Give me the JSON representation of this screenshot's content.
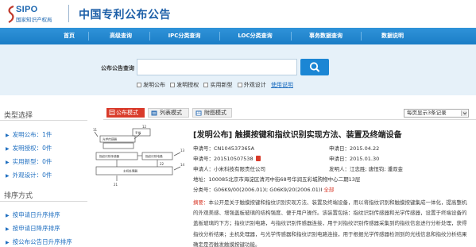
{
  "header": {
    "logo_text": "SIPO",
    "logo_sub": "国家知识产权局",
    "site_title": "中国专利公布公告"
  },
  "nav": {
    "items": [
      "首页",
      "高级查询",
      "IPC分类查询",
      "LOC分类查询",
      "事务数据查询",
      "数据说明"
    ]
  },
  "search": {
    "label": "公布公告查询",
    "value": "",
    "placeholder": "",
    "filters": [
      "发明公布",
      "发明授权",
      "实用新型",
      "外观设计"
    ],
    "help_link": "使用说明"
  },
  "sidebar": {
    "type_heading": "类型选择",
    "types": [
      "发明公布：1件",
      "发明授权：0件",
      "实用新型：0件",
      "外观设计：0件"
    ],
    "sort_heading": "排序方式",
    "sorts": [
      "按申请日升序排序",
      "按申请日降序排序",
      "按公布公告日升序排序"
    ]
  },
  "view": {
    "tabs": [
      "公布模式",
      "列表模式",
      "附图模式"
    ],
    "page_size": "每页显示3条记录"
  },
  "record": {
    "title": "[发明公布] 触摸按键和指纹识别实现方法、装置及终端设备",
    "app_no": "申请号：CN104537365A",
    "app_date": "申请日：2015.04.22",
    "pub_no": "申请号：201510507538",
    "pub_date": "申请日：2015.01.30",
    "applicant": "申请人：小米科技有限责任公司",
    "inventor": "发明人：江忠胜; 唐恒钧; 潘双金",
    "address": "地址：100085北京市海淀区清河中街68号华润五彩城购物中心二期13层",
    "ipc": "分类号：G06K9/00(2006.01)I; G06K9/20(2006.01)I",
    "ipc_more": "全部",
    "abstract_label": "摘要：",
    "abstract": "本公开是关于触摸按键和指纹识别实现方法、装置及终端设备，用以将指纹识别和触摸按键集成一体化，提高整机的外观美感、增强盖板玻璃的结构强度、便于用户操作。该装置包括：指纹识别传感器和光学传感器，设置于终端设备的盖板玻璃的下方；指纹识别电路，与指纹识别传感器连接，用于对指纹识别传感器采集到的指纹信息进行分析处理，获得指纹分析结果；主机处理器，与光学传感器和指纹识别电路连接，用于根据光学传感器检测到的光线信息和指纹分析结果确定是否触发触摸按键功能。"
  },
  "drawing": {
    "labels": [
      "光学传感器",
      "手指",
      "指纹识别传感器",
      "指纹识别电路",
      "主机处理器"
    ],
    "numbers": [
      "11",
      "12",
      "13",
      "14",
      "21",
      "22"
    ]
  },
  "colors": {
    "brand_blue": "#1d5fa8",
    "nav_blue": "#1b7dc6",
    "band_bg": "#e6f1f9",
    "accent_red": "#d93b2b",
    "link_blue": "#1f6fc0"
  }
}
